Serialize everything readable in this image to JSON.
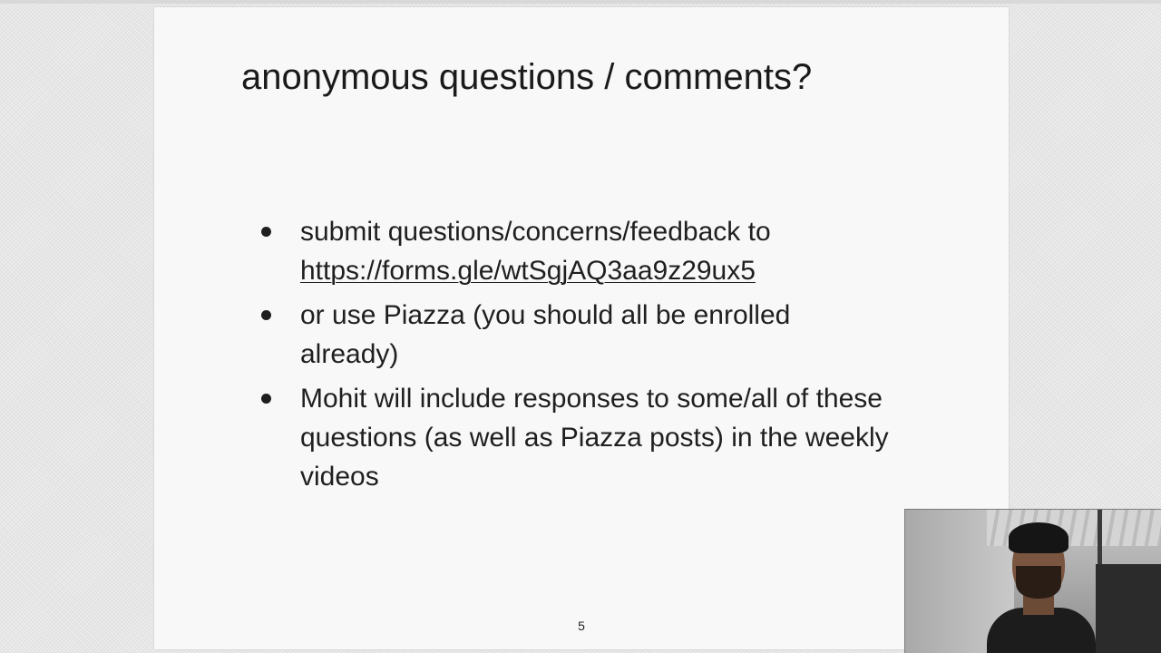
{
  "slide": {
    "title": "anonymous questions / comments?",
    "bullets": [
      {
        "text": "submit questions/concerns/feedback to",
        "link": "https://forms.gle/wtSgjAQ3aa9z29ux5"
      },
      {
        "text": "or use Piazza (you should all be enrolled already)"
      },
      {
        "text": "Mohit will include responses to some/all of these questions (as well as Piazza posts) in the weekly videos"
      }
    ],
    "page_number": "5"
  },
  "webcam": {
    "description_icon": "presenter-webcam"
  }
}
